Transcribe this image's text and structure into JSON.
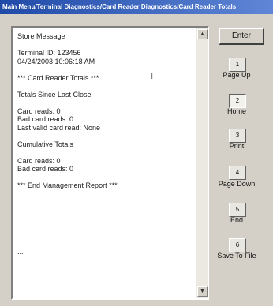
{
  "title": "Main Menu/Terminal Diagnostics/Card Reader Diagnostics/Card Reader Totals",
  "report": {
    "lines": [
      "Store Message",
      "",
      "Terminal ID: 123456",
      "04/24/2003 10:06:18 AM",
      "",
      "*** Card Reader Totals ***",
      "",
      "Totals Since Last Close",
      "",
      "Card reads: 0",
      "Bad card reads: 0",
      "Last valid card read: None",
      "",
      "Cumulative Totals",
      "",
      "Card reads: 0",
      "Bad card reads: 0",
      "",
      "*** End Management Report ***",
      "",
      "",
      "",
      "",
      "",
      "",
      "",
      "...",
      ""
    ]
  },
  "scrollbar": {
    "up_icon": "arrow-up-icon",
    "down_icon": "arrow-down-icon"
  },
  "buttons": {
    "enter": "Enter",
    "page_up": {
      "key": "1",
      "label": "Page Up"
    },
    "home": {
      "key": "2",
      "label": "Home"
    },
    "print": {
      "key": "3",
      "label": "Print"
    },
    "page_down": {
      "key": "4",
      "label": "Page Down"
    },
    "end": {
      "key": "5",
      "label": "End"
    },
    "save": {
      "key": "6",
      "label": "Save To File"
    }
  }
}
